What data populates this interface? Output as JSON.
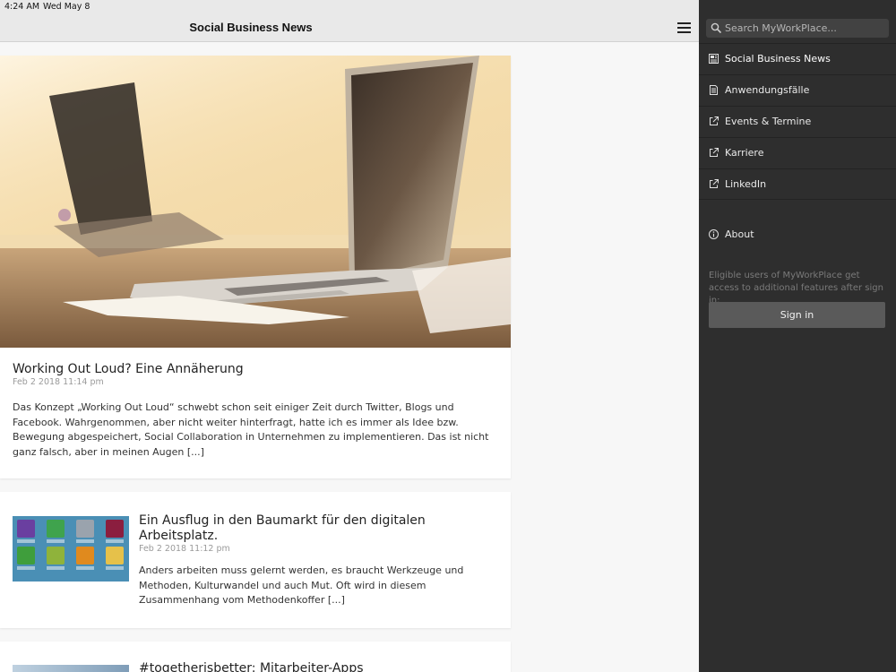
{
  "status_bar": {
    "time": "4:24 AM",
    "date": "Wed May 8"
  },
  "navbar": {
    "title": "Social Business News"
  },
  "posts": [
    {
      "title": "Working Out Loud? Eine Annäherung",
      "date": "Feb 2 2018 11:14 pm",
      "excerpt": "Das Konzept „Working Out Loud“ schwebt schon seit einiger Zeit durch Twitter, Blogs und Facebook. Wahrgenommen, aber nicht weiter hinterfragt, hatte ich es immer als Idee bzw. Bewegung abgespeichert, Social Collaboration in Unternehmen zu implementieren. Das ist nicht ganz falsch, aber in meinen Augen [...]"
    },
    {
      "title": "Ein Ausflug in den Baumarkt für den digitalen Arbeitsplatz.",
      "date": "Feb 2 2018 11:12 pm",
      "excerpt": "Anders arbeiten muss gelernt werden, es braucht Werkzeuge und Methoden, Kulturwandel und auch Mut. Oft wird in diesem Zusammenhang vom Methodenkoffer [...]"
    },
    {
      "title": "#togetherisbetter: Mitarbeiter-Apps"
    }
  ],
  "sidebar": {
    "search_placeholder": "Search MyWorkPlace...",
    "items": [
      {
        "label": "Social Business News",
        "icon": "newspaper-icon"
      },
      {
        "label": "Anwendungsfälle",
        "icon": "document-icon"
      },
      {
        "label": "Events & Termine",
        "icon": "external-link-icon"
      },
      {
        "label": "Karriere",
        "icon": "external-link-icon"
      },
      {
        "label": "LinkedIn",
        "icon": "external-link-icon"
      }
    ],
    "about_label": "About",
    "signin_note": "Eligible users of MyWorkPlace get access to additional features after sign in:",
    "signin_label": "Sign in"
  },
  "colors": {
    "sidebar_bg": "#2e2e2e",
    "navbar_bg": "#e9e9e9",
    "signin_button": "#5a5a5a"
  }
}
